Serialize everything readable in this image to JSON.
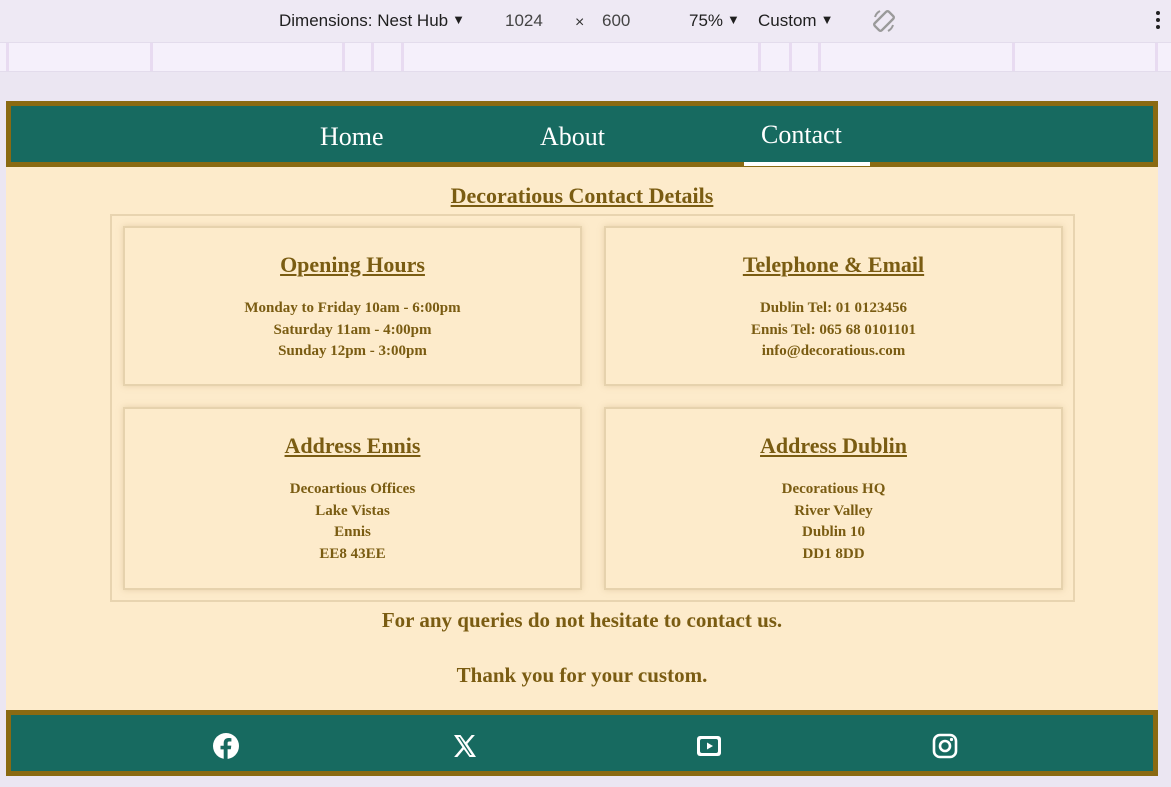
{
  "devtools": {
    "dimensions_label": "Dimensions: Nest Hub",
    "width": "1024",
    "times_symbol": "×",
    "height": "600",
    "zoom": "75%",
    "throttle": "Custom"
  },
  "nav": {
    "links": [
      {
        "label": "Home"
      },
      {
        "label": "About"
      },
      {
        "label": "Contact"
      }
    ],
    "active": "Contact"
  },
  "main": {
    "heading": "Decoratious Contact Details",
    "cards": [
      {
        "title": "Opening Hours",
        "lines": [
          "Monday to Friday 10am - 6:00pm",
          "Saturday 11am - 4:00pm",
          "Sunday 12pm - 3:00pm"
        ]
      },
      {
        "title": "Telephone & Email",
        "lines": [
          "Dublin Tel: 01 0123456",
          "Ennis Tel: 065 68 0101101",
          "info@decoratious.com"
        ]
      },
      {
        "title": "Address Ennis",
        "lines": [
          "Decoartious Offices",
          "Lake Vistas",
          "Ennis",
          "EE8 43EE"
        ]
      },
      {
        "title": "Address Dublin",
        "lines": [
          "Decoratious HQ",
          "River Valley",
          "Dublin 10",
          "DD1 8DD"
        ]
      }
    ],
    "closing": [
      "For any queries do not hesitate to contact us.",
      "Thank you for your custom."
    ]
  },
  "footer": {
    "icons": [
      "facebook-icon",
      "x-twitter-icon",
      "youtube-icon",
      "instagram-icon"
    ]
  },
  "colors": {
    "nav_bg": "#176a60",
    "border_gold": "#8a6a12",
    "page_bg": "#fdebcb",
    "text_brown": "#7a5c12"
  }
}
